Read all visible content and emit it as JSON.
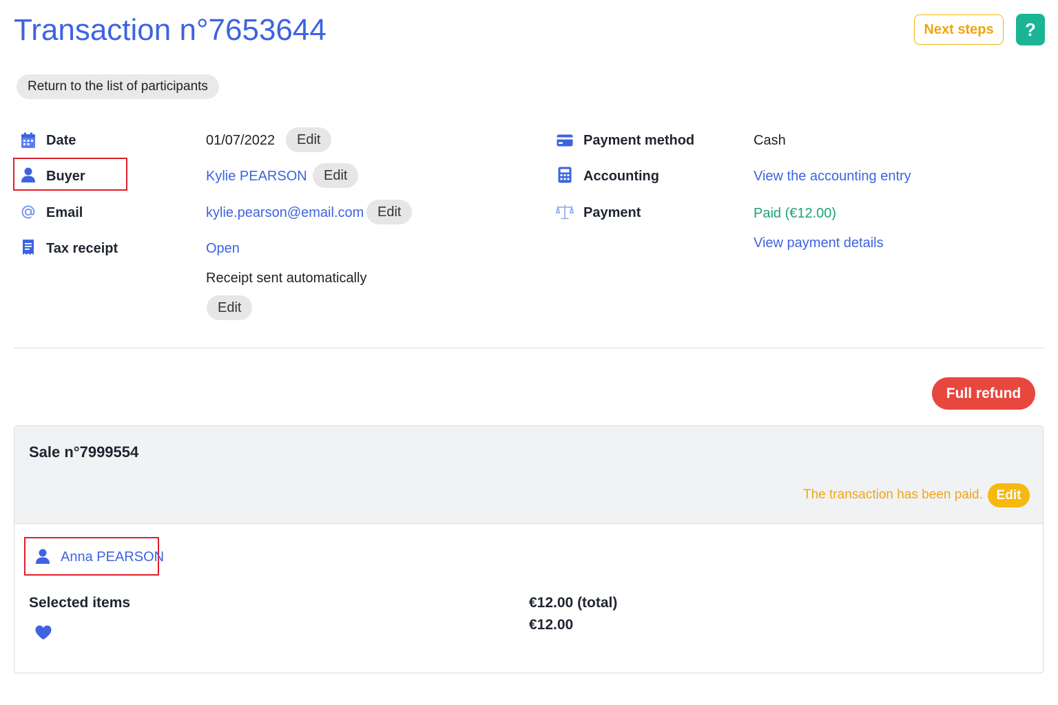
{
  "header": {
    "title": "Transaction n°7653644",
    "next_steps_label": "Next steps",
    "help_label": "?"
  },
  "return_label": "Return to the list of participants",
  "details": {
    "date": {
      "label": "Date",
      "value": "01/07/2022",
      "edit": "Edit"
    },
    "buyer": {
      "label": "Buyer",
      "value": "Kylie PEARSON",
      "edit": "Edit"
    },
    "email": {
      "label": "Email",
      "value": "kylie.pearson@email.com",
      "edit": "Edit"
    },
    "tax_receipt": {
      "label": "Tax receipt",
      "link": "Open",
      "note": "Receipt sent automatically",
      "edit": "Edit"
    },
    "payment_method": {
      "label": "Payment method",
      "value": "Cash"
    },
    "accounting": {
      "label": "Accounting",
      "link": "View the accounting entry"
    },
    "payment": {
      "label": "Payment",
      "status": "Paid (€12.00)",
      "details_link": "View payment details"
    }
  },
  "refund_label": "Full refund",
  "sale": {
    "title": "Sale n°7999554",
    "status_text": "The transaction has been paid.",
    "status_edit": "Edit",
    "participant": "Anna PEARSON",
    "selected_items_label": "Selected items",
    "total": "€12.00 (total)",
    "item_price": "€12.00"
  },
  "colors": {
    "primary": "#3d63e0",
    "accent_orange": "#f3a30b",
    "help_green": "#1bb594",
    "refund_red": "#e8473e",
    "paid_green": "#1aa37a",
    "highlight_red": "#e01e2a"
  },
  "icons": [
    "calendar-icon",
    "user-icon",
    "at-icon",
    "receipt-icon",
    "credit-card-icon",
    "calculator-icon",
    "scale-icon",
    "heart-icon"
  ]
}
